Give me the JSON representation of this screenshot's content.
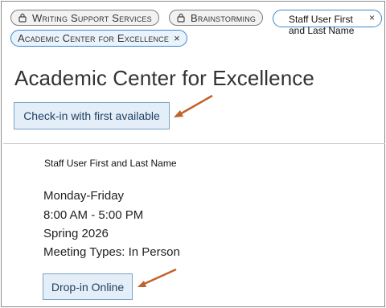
{
  "chips": [
    {
      "label": "Writing Support Services",
      "icon": "lock-icon"
    },
    {
      "label": "Brainstorming",
      "icon": "lock-icon"
    }
  ],
  "staff_chip": {
    "text": "Staff User First and Last Name",
    "remove": "×"
  },
  "center_chip": {
    "label": "Academic Center for Excellence",
    "remove": "×"
  },
  "page_title": "Academic Center for Excellence",
  "checkin_button": "Check-in with first available",
  "staff_section": {
    "name": "Staff User First and Last Name",
    "days": "Monday-Friday",
    "hours": "8:00 AM - 5:00 PM",
    "term": "Spring 2026",
    "meeting_types": "Meeting Types: In Person",
    "dropin_button": "Drop-in Online"
  },
  "colors": {
    "arrow": "#c0622a",
    "button_bg": "#e4eef8",
    "chip_selected_border": "#3e86c9"
  }
}
